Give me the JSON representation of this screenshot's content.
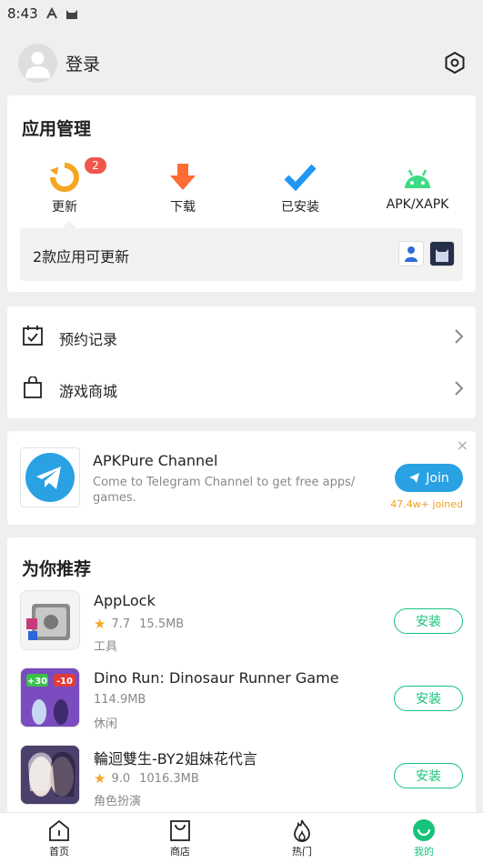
{
  "status_bar": {
    "time": "8:43"
  },
  "header": {
    "login_label": "登录"
  },
  "app_management": {
    "title": "应用管理",
    "items": [
      {
        "label": "更新",
        "icon": "update-icon",
        "badge": "2"
      },
      {
        "label": "下载",
        "icon": "download-icon"
      },
      {
        "label": "已安装",
        "icon": "installed-check-icon"
      },
      {
        "label": "APK/XAPK",
        "icon": "android-icon"
      }
    ],
    "update_notice": "2款应用可更新"
  },
  "menu": {
    "items": [
      {
        "label": "预约记录",
        "icon": "calendar-check-icon"
      },
      {
        "label": "游戏商城",
        "icon": "shopping-bag-icon"
      }
    ]
  },
  "telegram": {
    "title": "APKPure Channel",
    "description": "Come to Telegram Channel to get free apps/ games.",
    "join_label": "Join",
    "joined_count": "47.4w+ joined",
    "close_label": "×"
  },
  "recommend": {
    "title": "为你推荐",
    "install_label": "安装",
    "apps": [
      {
        "name": "AppLock",
        "rating": "7.7",
        "size": "15.5MB",
        "category": "工具"
      },
      {
        "name": "Dino Run: Dinosaur Runner Game",
        "rating": "",
        "size": "114.9MB",
        "category": "休闲"
      },
      {
        "name": "輪迴雙生-BY2姐妹花代言",
        "rating": "9.0",
        "size": "1016.3MB",
        "category": "角色扮演"
      }
    ]
  },
  "bottom_nav": [
    {
      "label": "首页",
      "icon": "home-icon"
    },
    {
      "label": "商店",
      "icon": "store-icon"
    },
    {
      "label": "热门",
      "icon": "flame-icon"
    },
    {
      "label": "我的",
      "icon": "smiley-profile-icon"
    }
  ],
  "colors": {
    "accent": "#17c37a",
    "badge": "#f1564b",
    "telegram": "#2aa1e3",
    "update_orange": "#f5a623",
    "download_orange": "#ff6b35",
    "check_blue": "#2196f3",
    "android_green": "#3ddc84"
  }
}
